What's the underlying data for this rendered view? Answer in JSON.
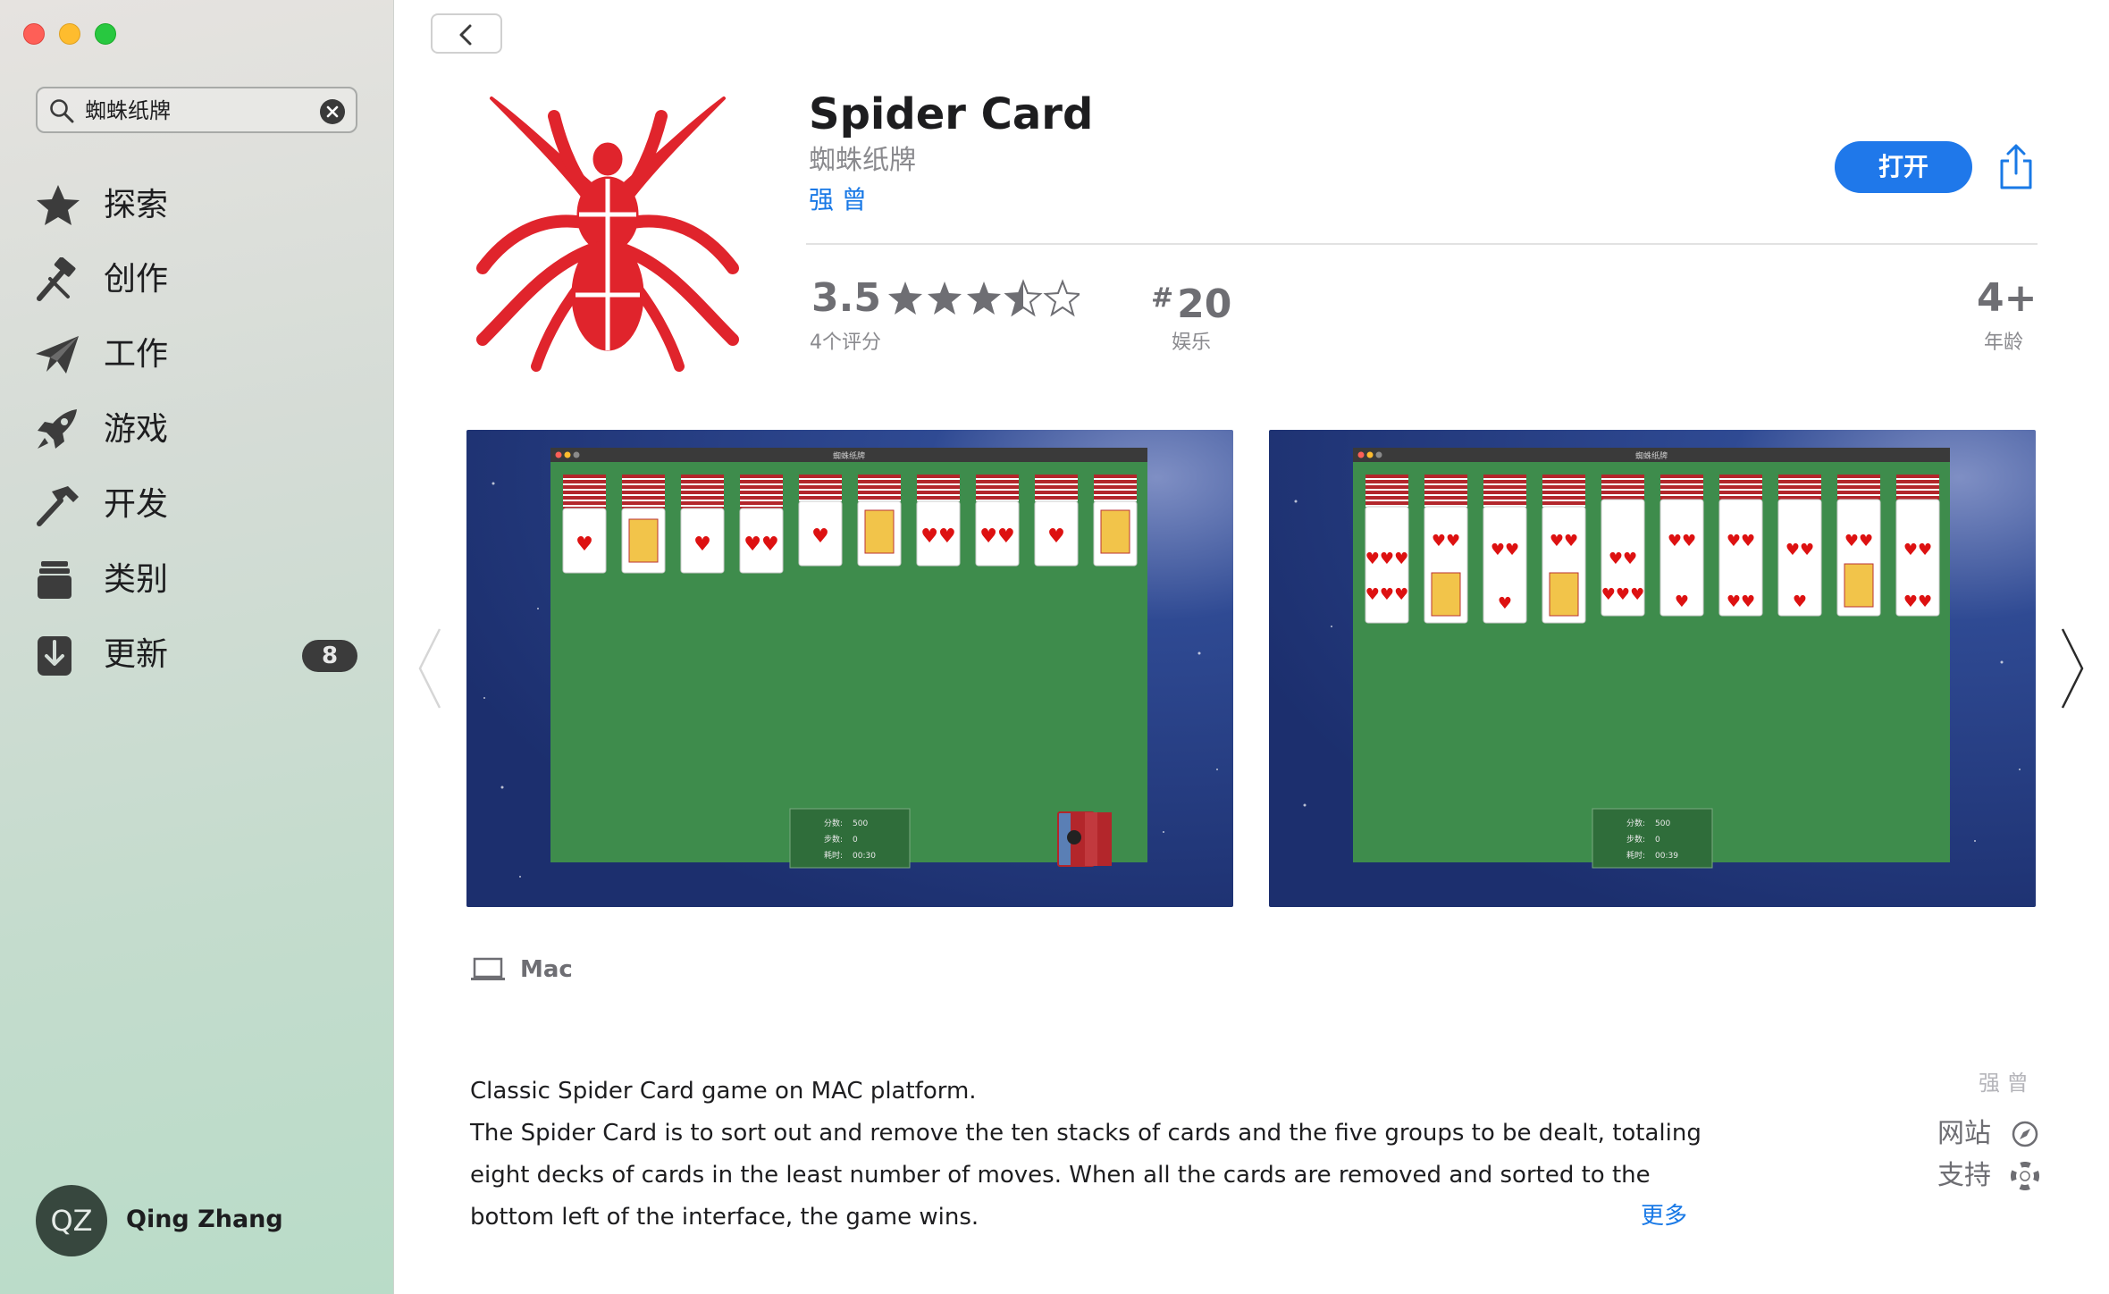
{
  "window": {
    "controls": [
      "close",
      "minimize",
      "zoom"
    ]
  },
  "sidebar": {
    "search": {
      "value": "蜘蛛纸牌"
    },
    "items": [
      {
        "label": "探索",
        "icon": "star-icon"
      },
      {
        "label": "创作",
        "icon": "hammer-brush-icon"
      },
      {
        "label": "工作",
        "icon": "paper-plane-icon"
      },
      {
        "label": "游戏",
        "icon": "rocket-icon"
      },
      {
        "label": "开发",
        "icon": "hammer-icon"
      },
      {
        "label": "类别",
        "icon": "stack-icon"
      },
      {
        "label": "更新",
        "icon": "download-icon",
        "badge": "8"
      }
    ],
    "user": {
      "initials": "QZ",
      "name": "Qing Zhang"
    }
  },
  "app": {
    "title": "Spider Card",
    "subtitle": "蜘蛛纸牌",
    "developer": "强 曾",
    "open_label": "打开",
    "rating": {
      "value": "3.5",
      "stars": 3.5,
      "count_label": "4个评分"
    },
    "rank": {
      "hash": "#",
      "value": "20",
      "category": "娱乐"
    },
    "age": {
      "value": "4+",
      "label": "年龄"
    },
    "accent_color": "#1f78ea",
    "icon_color": "#e0242c"
  },
  "screenshots": [
    {
      "window_title": "蜘蛛纸牌",
      "score_label": "分数:",
      "score": "500",
      "moves_label": "步数:",
      "moves": "0",
      "time_label": "耗时:",
      "time": "00:30"
    },
    {
      "window_title": "蜘蛛纸牌",
      "score_label": "分数:",
      "score": "500",
      "moves_label": "步数:",
      "moves": "0",
      "time_label": "耗时:",
      "time": "00:39"
    }
  ],
  "platform": {
    "label": "Mac"
  },
  "description": {
    "line1": "Classic Spider Card game on MAC platform.",
    "line2": "The Spider Card is to sort out and remove the ten stacks of cards and the five groups to be dealt, totaling eight decks of cards in the least number of moves. When all the cards are removed and sorted to the bottom left of the interface, the game wins.",
    "more_label": "更多"
  },
  "links": {
    "developer": "强 曾",
    "website": "网站",
    "support": "支持"
  }
}
